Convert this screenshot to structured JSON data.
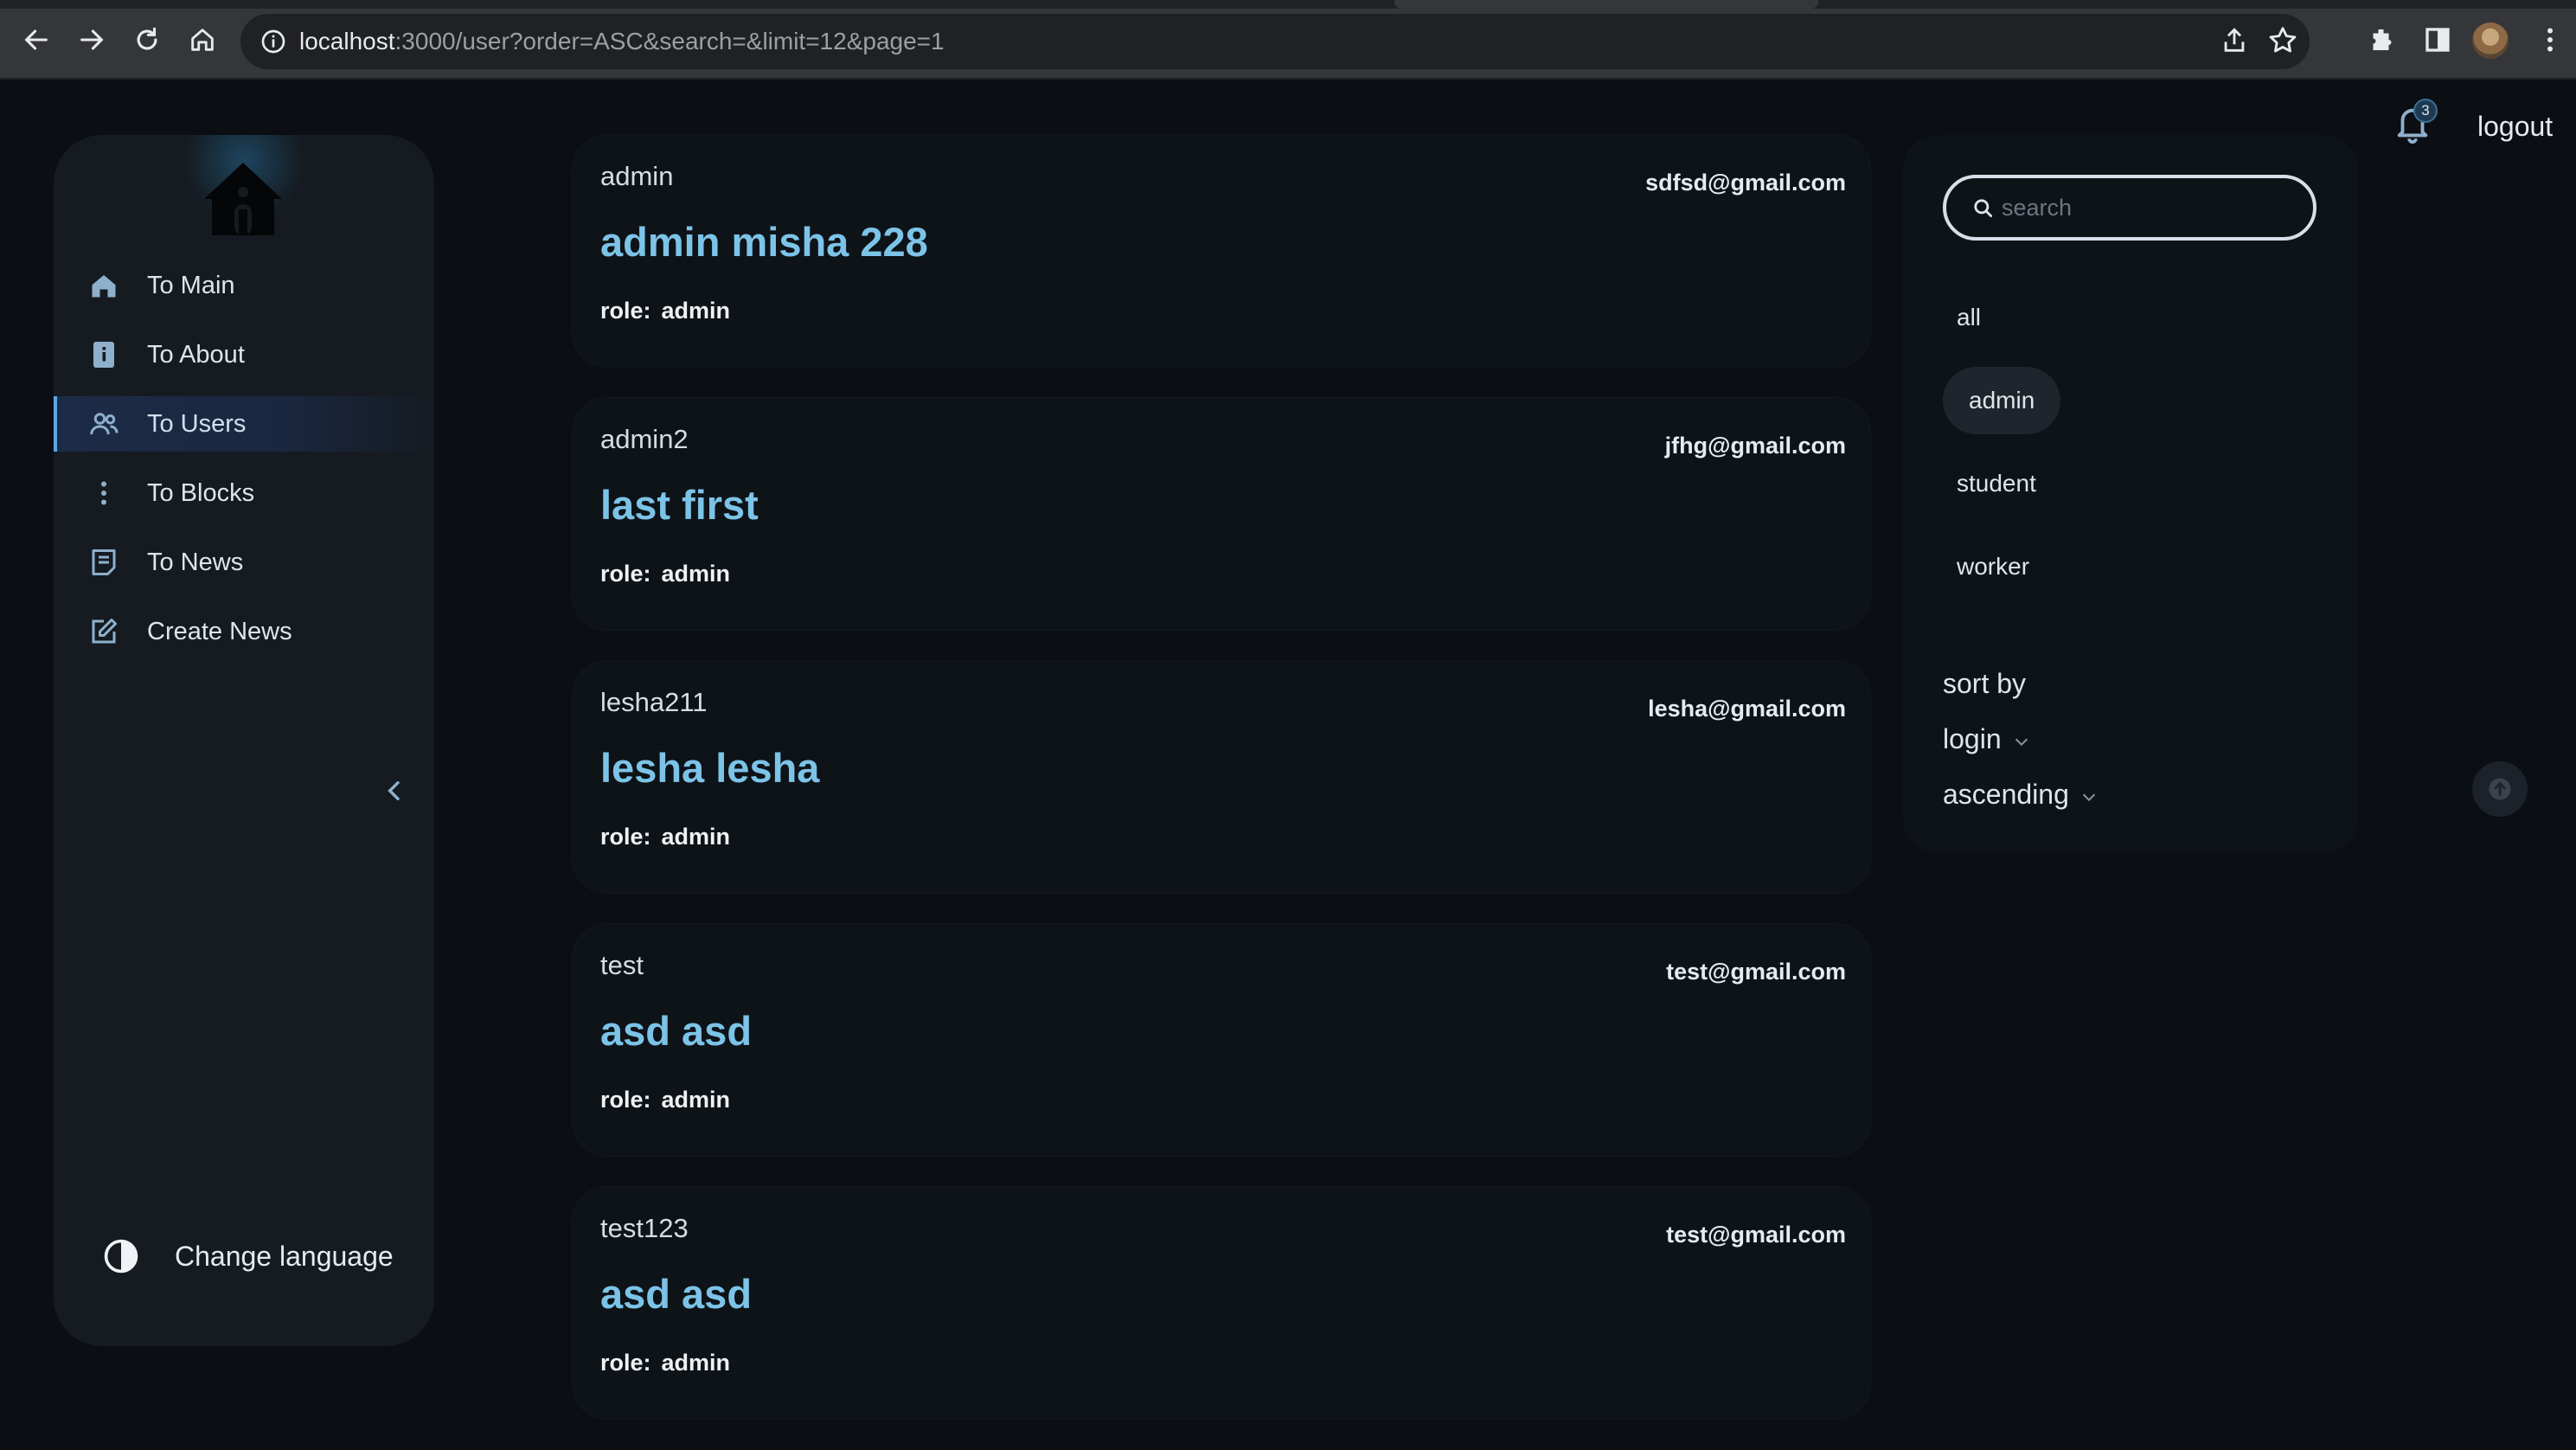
{
  "browser": {
    "url_host": "localhost",
    "url_rest": ":3000/user?order=ASC&search=&limit=12&page=1"
  },
  "sidebar": {
    "items": [
      {
        "label": "To Main",
        "icon": "home-icon"
      },
      {
        "label": "To About",
        "icon": "info-book-icon"
      },
      {
        "label": "To Users",
        "icon": "users-icon",
        "active": true
      },
      {
        "label": "To Blocks",
        "icon": "vertical-dots-icon"
      },
      {
        "label": "To News",
        "icon": "news-icon"
      },
      {
        "label": "Create News",
        "icon": "edit-icon"
      }
    ],
    "language_label": "Change language"
  },
  "header": {
    "notification_count": "3",
    "logout_label": "logout"
  },
  "users": [
    {
      "login": "admin",
      "email": "sdfsd@gmail.com",
      "name": "admin misha 228",
      "role_label": "role:",
      "role": "admin"
    },
    {
      "login": "admin2",
      "email": "jfhg@gmail.com",
      "name": "last first",
      "role_label": "role:",
      "role": "admin"
    },
    {
      "login": "lesha211",
      "email": "lesha@gmail.com",
      "name": "lesha lesha",
      "role_label": "role:",
      "role": "admin"
    },
    {
      "login": "test",
      "email": "test@gmail.com",
      "name": "asd asd",
      "role_label": "role:",
      "role": "admin"
    },
    {
      "login": "test123",
      "email": "test@gmail.com",
      "name": "asd asd",
      "role_label": "role:",
      "role": "admin"
    }
  ],
  "filters": {
    "search_placeholder": "search",
    "search_value": "",
    "role_tabs": [
      "all",
      "admin",
      "student",
      "worker"
    ],
    "selected_tab": "admin",
    "sort_by_label": "sort by",
    "sort_field": "login",
    "sort_order": "ascending"
  },
  "colors": {
    "accent": "#7cc3e8",
    "background": "#0b0f13",
    "card": "#0e1318",
    "sidebar": "#151b21"
  }
}
